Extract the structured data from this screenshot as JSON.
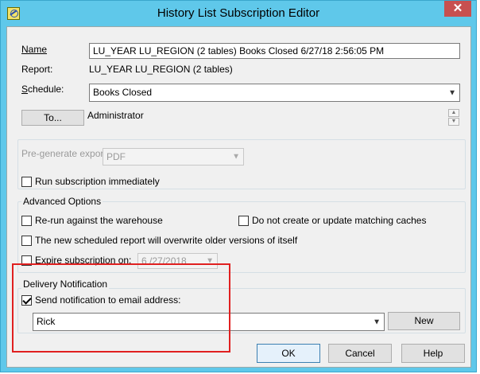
{
  "window": {
    "title": "History List Subscription Editor",
    "close_glyph": "✕",
    "app_icon": "subscription-editor-icon"
  },
  "form": {
    "name_label": "Name",
    "name_value": "LU_YEAR LU_REGION (2 tables) Books Closed 6/27/18 2:56:05 PM",
    "report_label": "Report:",
    "report_value": "LU_YEAR LU_REGION (2 tables)",
    "schedule_label": "Schedule:",
    "schedule_value": "Books Closed",
    "to_button": "To...",
    "to_value": "Administrator",
    "spin_up": "▲",
    "spin_down": "▼"
  },
  "export": {
    "pregenerate_label": "Pre-generate export:",
    "pregenerate_value": "PDF",
    "run_immediately": "Run subscription immediately"
  },
  "advanced": {
    "title": "Advanced Options",
    "rerun": "Re-run against the warehouse",
    "no_caches": "Do not create or update matching caches",
    "overwrite": "The new scheduled report will overwrite older versions of itself",
    "expire": "Expire subscription on:",
    "expire_date": "6 /27/2018"
  },
  "delivery": {
    "title": "Delivery Notification",
    "send_email": "Send notification to email address:",
    "email_value": "Rick",
    "new_button": "New"
  },
  "footer": {
    "ok": "OK",
    "cancel": "Cancel",
    "help": "Help"
  },
  "colors": {
    "titlebar": "#5fc8ea",
    "close_button": "#c75050",
    "highlight": "#e02020"
  }
}
